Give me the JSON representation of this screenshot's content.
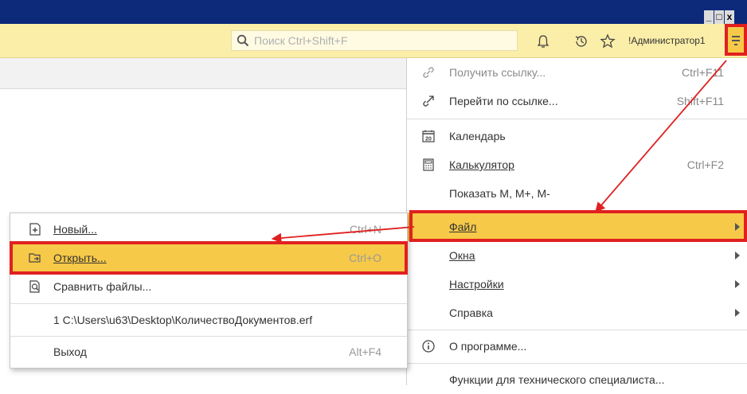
{
  "window": {
    "controls": [
      "_",
      "á",
      "x"
    ]
  },
  "toolbar": {
    "search_placeholder": "Поиск Ctrl+Shift+F",
    "user_name": "!Администратор1"
  },
  "main_menu": {
    "get_link": {
      "label": "Получить ссылку...",
      "shortcut": "Ctrl+F11"
    },
    "go_link": {
      "label": "Перейти по ссылке...",
      "shortcut": "Shift+F11"
    },
    "calendar": {
      "label": "Календарь",
      "icon_text": "20"
    },
    "calculator": {
      "label": "Калькулятор",
      "shortcut": "Ctrl+F2"
    },
    "show_m": {
      "label": "Показать М, М+, М-"
    },
    "file": {
      "label": "Файл"
    },
    "windows": {
      "label": "Окна"
    },
    "settings": {
      "label": "Настройки"
    },
    "help": {
      "label": "Справка"
    },
    "about": {
      "label": "О программе..."
    },
    "tech_functions": {
      "label": "Функции для технического специалиста..."
    }
  },
  "file_submenu": {
    "new": {
      "label": "Новый...",
      "shortcut": "Ctrl+N"
    },
    "open": {
      "label": "Открыть...",
      "shortcut": "Ctrl+O"
    },
    "compare": {
      "label": "Сравнить файлы..."
    },
    "recent": {
      "label": "1 C:\\Users\\u63\\Desktop\\КоличествоДокументов.erf"
    },
    "exit": {
      "label": "Выход",
      "shortcut": "Alt+F4"
    }
  },
  "colors": {
    "title_bar": "#0d2a7a",
    "toolbar": "#fbeea8",
    "highlight": "#f7c948",
    "annotation_red": "#e02020"
  }
}
